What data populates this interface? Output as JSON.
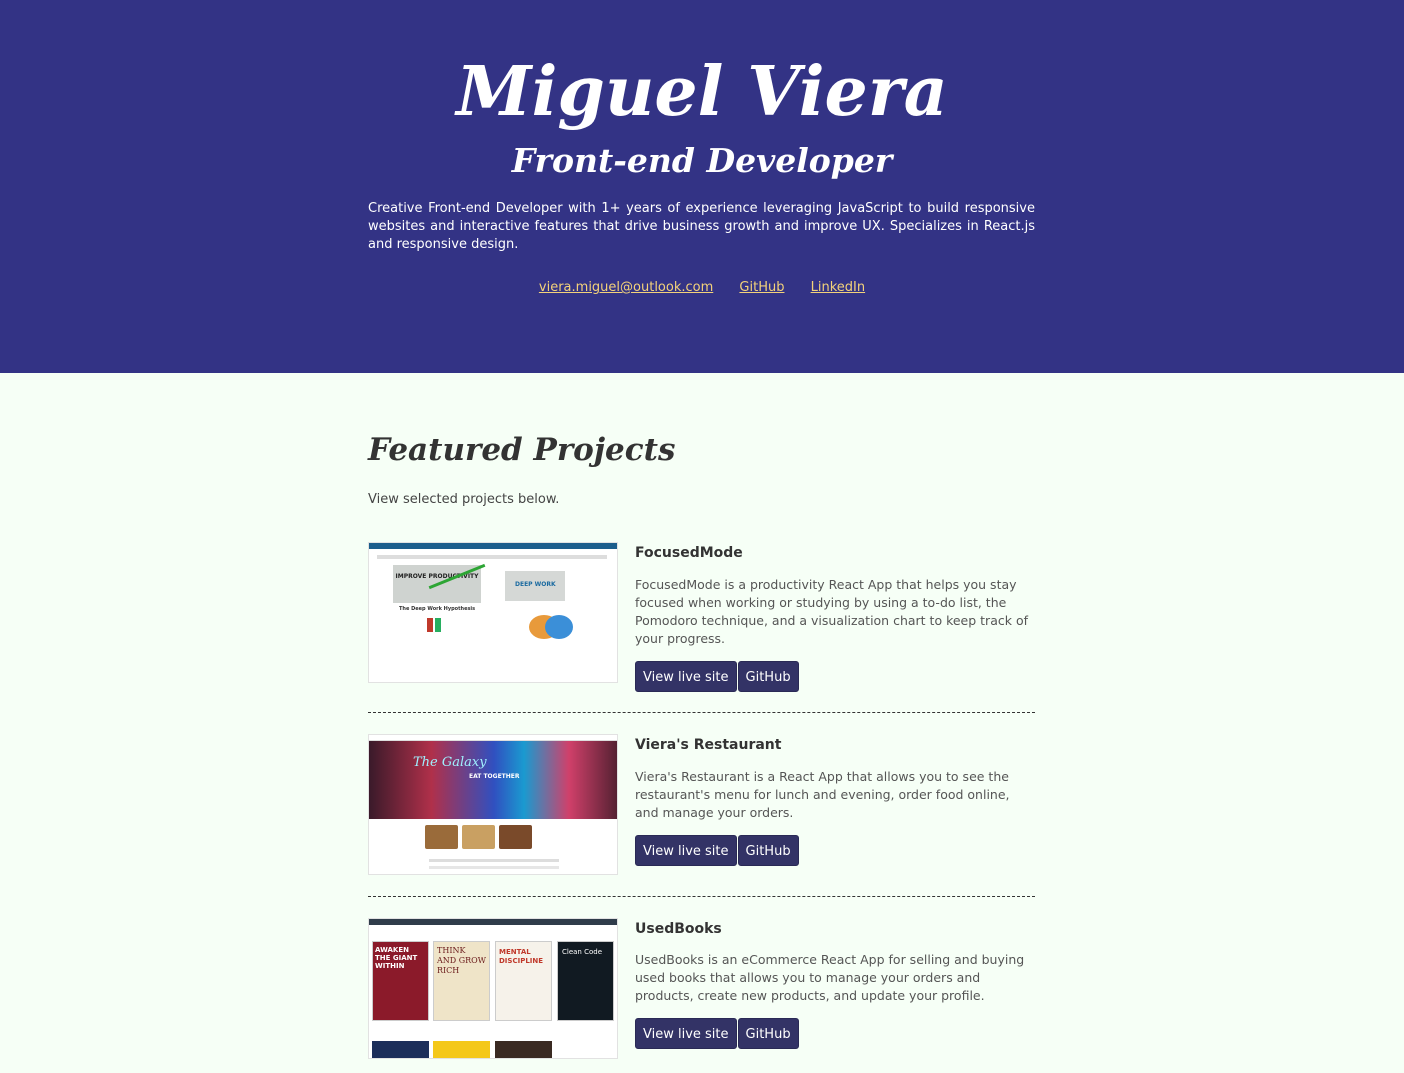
{
  "hero": {
    "name": "Miguel Viera",
    "role": "Front-end Developer",
    "description": "Creative Front-end Developer with 1+ years of experience leveraging JavaScript to build responsive websites and interactive features that drive business growth and improve UX. Specializes in React.js and responsive design.",
    "links": {
      "email": "viera.miguel@outlook.com",
      "github": "GitHub",
      "linkedin": "LinkedIn"
    }
  },
  "colors": {
    "hero_bg": "#333385",
    "page_bg": "#f6fff6",
    "link": "#f3d27a",
    "button_bg": "#333366"
  },
  "featured": {
    "title": "Featured Projects",
    "subtitle": "View selected projects below."
  },
  "projects": [
    {
      "title": "FocusedMode",
      "description": "FocusedMode is a productivity React App that helps you stay focused when working or studying by using a to-do list, the Pomodoro technique, and a visualization chart to keep track of your progress.",
      "live_label": "View live site",
      "github_label": "GitHub",
      "thumb_text": {
        "improve": "IMPROVE PRODUCTIVITY",
        "deep": "DEEP WORK",
        "hypothesis": "The Deep Work Hypothesis"
      }
    },
    {
      "title": "Viera's Restaurant",
      "description": "Viera's Restaurant is a React App that allows you to see the restaurant's menu for lunch and evening, order food online, and manage your orders.",
      "live_label": "View live site",
      "github_label": "GitHub",
      "thumb_text": {
        "neon": "The Galaxy",
        "sign": "EAT TOGETHER"
      }
    },
    {
      "title": "UsedBooks",
      "description": "UsedBooks is an eCommerce React App for selling and buying used books that allows you to manage your orders and products, create new products, and update your profile.",
      "live_label": "View live site",
      "github_label": "GitHub",
      "thumb_text": {
        "book1": "AWAKEN THE GIANT WITHIN",
        "book2": "THINK AND GROW RICH",
        "book3": "MENTAL DISCIPLINE",
        "book4": "Clean Code"
      }
    }
  ]
}
